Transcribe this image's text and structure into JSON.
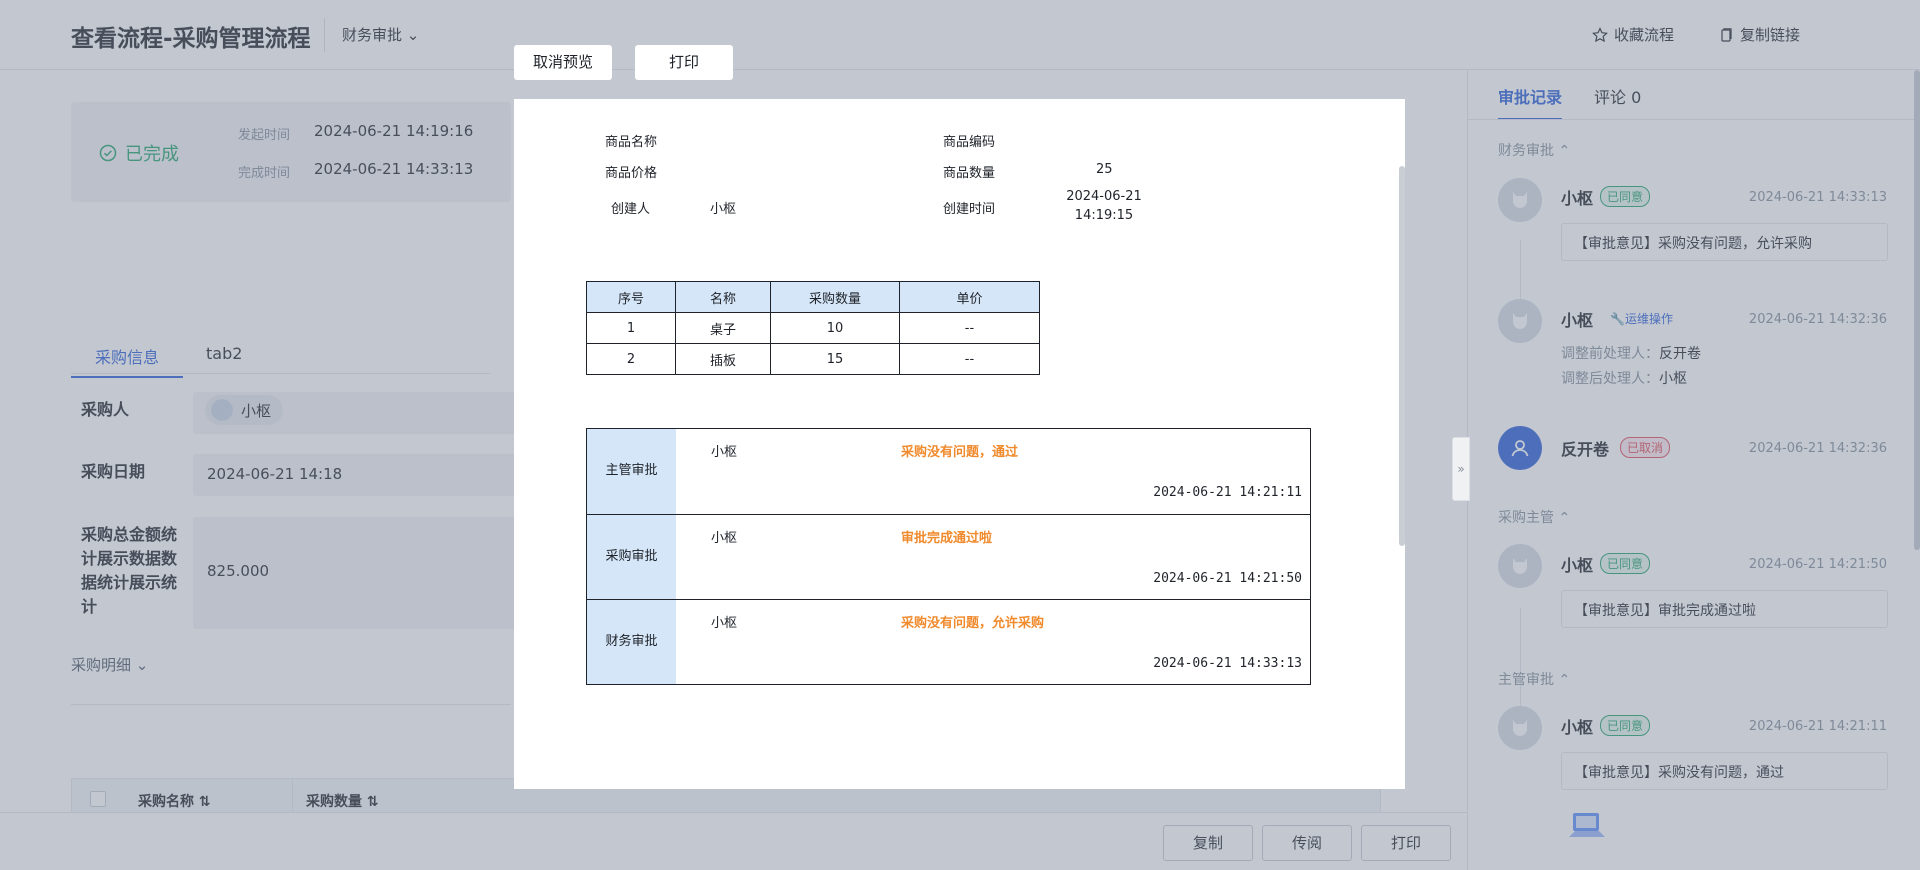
{
  "header": {
    "title": "查看流程-采购管理流程",
    "stage": "财务审批",
    "favorite": "收藏流程",
    "copy_link": "复制链接"
  },
  "status": {
    "state": "已完成",
    "start_label": "发起时间",
    "start_value": "2024-06-21 14:19:16",
    "end_label": "完成时间",
    "end_value": "2024-06-21 14:33:13"
  },
  "tabs": [
    "采购信息",
    "tab2"
  ],
  "form": {
    "buyer_label": "采购人",
    "buyer_value": "小枢",
    "date_label": "采购日期",
    "date_value": "2024-06-21 14:18",
    "amount_label": "采购总金额统计展示数据数据统计展示统计",
    "amount_value": "825.000",
    "detail_toggle": "采购明细"
  },
  "detail_table": {
    "headers": [
      "采购名称",
      "采购数量"
    ]
  },
  "bottom_actions": [
    "复制",
    "传阅",
    "打印"
  ],
  "preview": {
    "cancel": "取消预览",
    "print": "打印",
    "fields": {
      "name_label": "商品名称",
      "name_value": "",
      "code_label": "商品编码",
      "code_value": "",
      "price_label": "商品价格",
      "price_value": "",
      "qty_label": "商品数量",
      "qty_value": "25",
      "creator_label": "创建人",
      "creator_value": "小枢",
      "created_label": "创建时间",
      "created_date": "2024-06-21",
      "created_time": "14:19:15"
    },
    "items_table": {
      "headers": [
        "序号",
        "名称",
        "采购数量",
        "单价"
      ],
      "rows": [
        [
          "1",
          "桌子",
          "10",
          "--"
        ],
        [
          "2",
          "插板",
          "15",
          "--"
        ]
      ]
    },
    "approvals": [
      {
        "node": "主管审批",
        "person": "小枢",
        "opinion": "采购没有问题，通过",
        "time": "2024-06-21 14:21:11"
      },
      {
        "node": "采购审批",
        "person": "小枢",
        "opinion": "审批完成通过啦",
        "time": "2024-06-21 14:21:50"
      },
      {
        "node": "财务审批",
        "person": "小枢",
        "opinion": "采购没有问题，允许采购",
        "time": "2024-06-21 14:33:13"
      }
    ]
  },
  "right_panel": {
    "tab_records": "审批记录",
    "tab_comments": "评论 0",
    "groups": [
      {
        "name": "财务审批"
      },
      {
        "name": "采购主管"
      },
      {
        "name": "主管审批"
      }
    ],
    "entries": [
      {
        "name": "小枢",
        "badge": "已同意",
        "time": "2024-06-21 14:33:13",
        "comment": "【审批意见】采购没有问题，允许采购"
      },
      {
        "name": "小枢",
        "badge": "运维操作",
        "time": "2024-06-21 14:32:36",
        "before_label": "调整前处理人：",
        "before_value": "反开卷",
        "after_label": "调整后处理人：",
        "after_value": "小枢"
      },
      {
        "name": "反开卷",
        "badge": "已取消",
        "time": "2024-06-21 14:32:36"
      },
      {
        "name": "小枢",
        "badge": "已同意",
        "time": "2024-06-21 14:21:50",
        "comment": "【审批意见】审批完成通过啦"
      },
      {
        "name": "小枢",
        "badge": "已同意",
        "time": "2024-06-21 14:21:11",
        "comment": "【审批意见】采购没有问题，通过"
      }
    ]
  },
  "colors": {
    "accent": "#2b5fd9",
    "success": "#21a56b",
    "cancel": "#e34d59",
    "opinion": "#f08a2c",
    "header_cell": "#d5e6f8"
  }
}
